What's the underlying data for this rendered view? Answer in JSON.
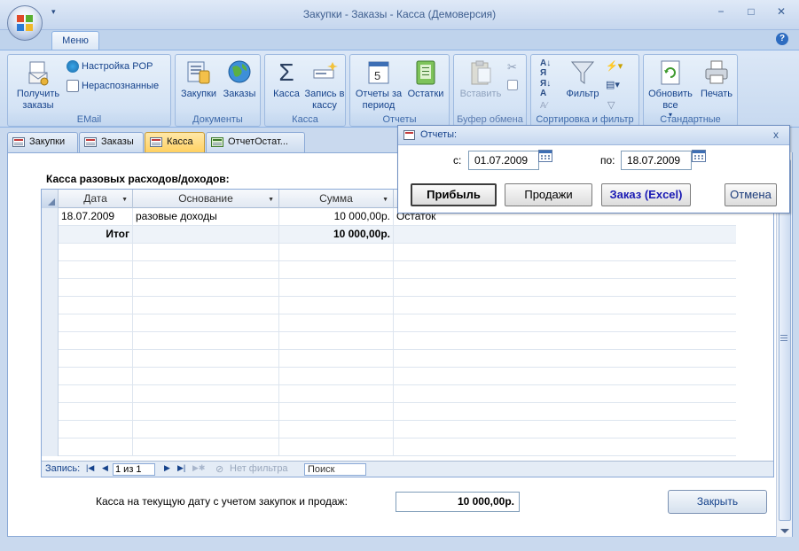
{
  "window": {
    "title": "Закупки - Заказы - Касса (Демоверсия)",
    "controls": [
      "−",
      "□",
      "✕"
    ]
  },
  "ribbon": {
    "tab_label": "Меню",
    "groups": {
      "email": {
        "label": "EMail",
        "get_orders": "Получить заказы",
        "pop_settings": "Настройка POP",
        "unrecognized": "Нераспознанные"
      },
      "documents": {
        "label": "Документы",
        "purchases": "Закупки",
        "orders": "Заказы"
      },
      "cash": {
        "label": "Касса",
        "cash": "Касса",
        "write_cash": "Запись в кассу"
      },
      "reports": {
        "label": "Отчеты",
        "period_reports": "Отчеты за период",
        "stock": "Остатки"
      },
      "clipboard": {
        "label": "Буфер обмена",
        "paste": "Вставить"
      },
      "sort_filter": {
        "label": "Сортировка и фильтр",
        "filter": "Фильтр"
      },
      "standard": {
        "label": "Стандартные",
        "refresh_all": "Обновить все",
        "print": "Печать"
      }
    }
  },
  "doc_tabs": [
    {
      "label": "Закупки"
    },
    {
      "label": "Заказы"
    },
    {
      "label": "Касса"
    },
    {
      "label": "ОтчетОстат..."
    }
  ],
  "form": {
    "title": "Касса разовых расходов/доходов:",
    "columns": [
      "Дата",
      "Основание",
      "Сумма"
    ],
    "rows": [
      {
        "date": "18.07.2009",
        "basis": "разовые доходы",
        "amount": "10 000,00р.",
        "note": "Остаток"
      }
    ],
    "total": {
      "label": "Итог",
      "amount": "10 000,00р."
    },
    "status": {
      "record_label": "Запись:",
      "record_value": "1 из 1",
      "no_filter": "Нет фильтра",
      "search": "Поиск"
    },
    "bottom_label": "Касса на текущую дату с учетом закупок и продаж:",
    "bottom_value": "10 000,00р.",
    "close_button": "Закрыть"
  },
  "dialog": {
    "title": "Отчеты:",
    "from_label": "с:",
    "from_value": "01.07.2009",
    "to_label": "по:",
    "to_value": "18.07.2009",
    "buttons": {
      "profit": "Прибыль",
      "sales": "Продажи",
      "order_excel": "Заказ (Excel)",
      "cancel": "Отмена"
    }
  }
}
